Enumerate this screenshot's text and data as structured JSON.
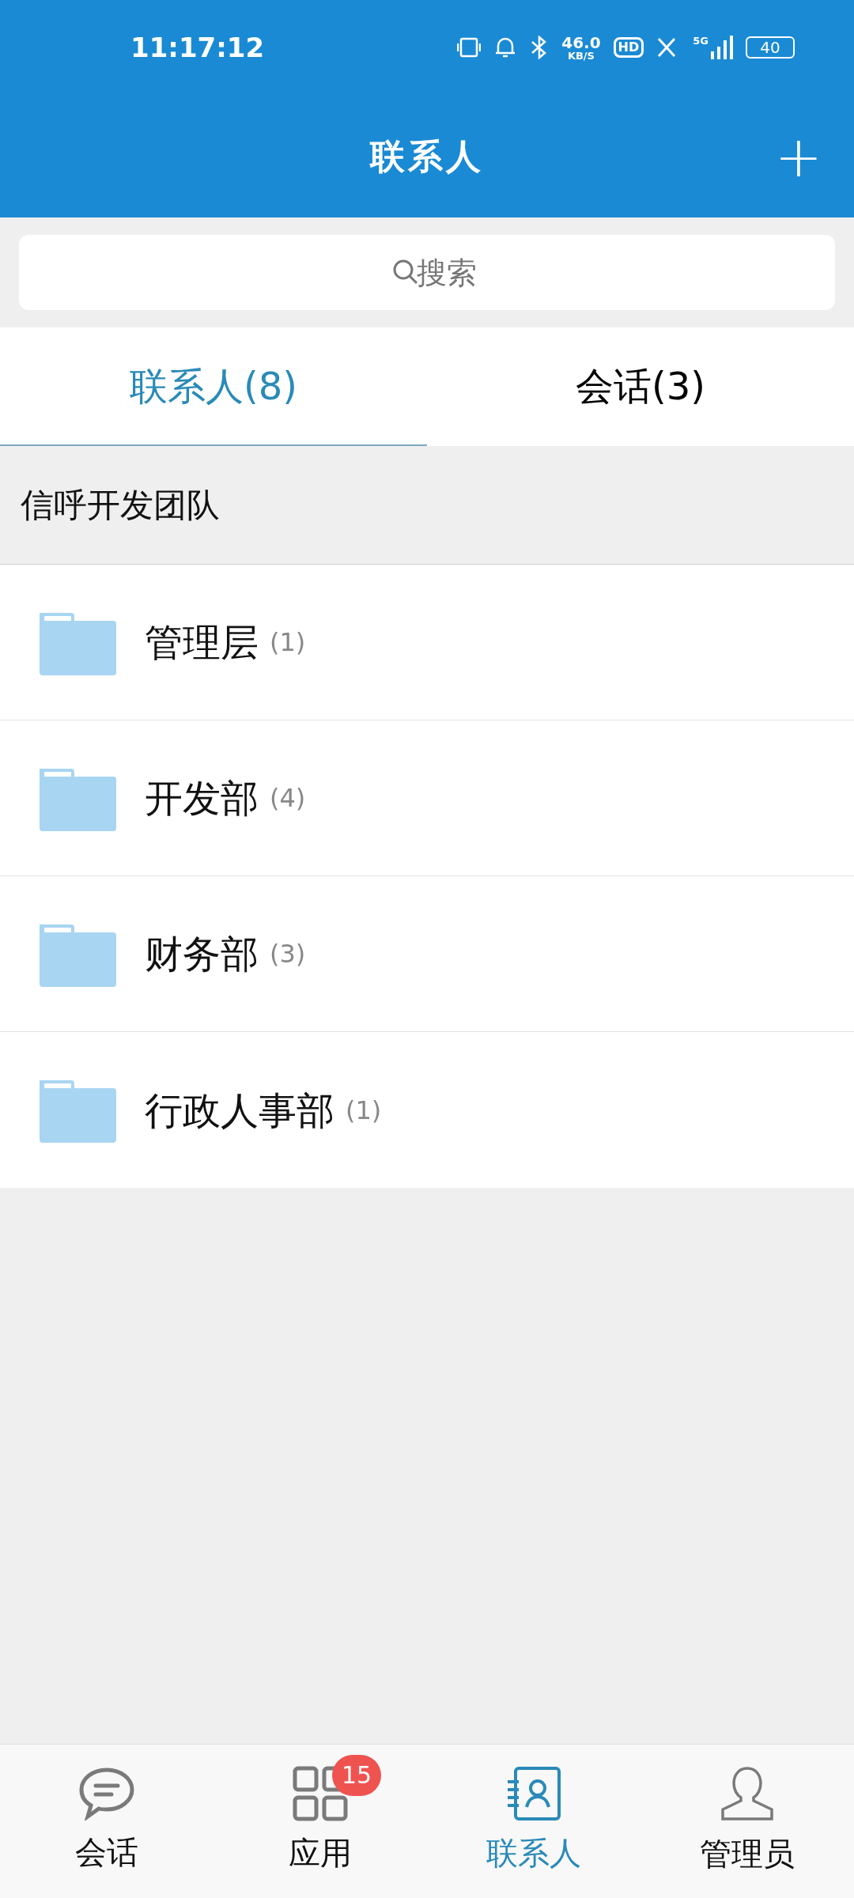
{
  "status_bar": {
    "time": "11:17:12",
    "net_speed": "46.0",
    "net_unit": "KB/S",
    "hd": "HD",
    "network": "5G",
    "battery": "40"
  },
  "header": {
    "title": "联系人",
    "add": "+"
  },
  "search": {
    "placeholder": "搜索"
  },
  "tabs": [
    {
      "label": "联系人(8)",
      "selected": true
    },
    {
      "label": "会话(3)",
      "selected": false
    }
  ],
  "group": {
    "title": "信呼开发团队"
  },
  "folders": [
    {
      "name": "管理层",
      "count": "(1)"
    },
    {
      "name": "开发部",
      "count": "(4)"
    },
    {
      "name": "财务部",
      "count": "(3)"
    },
    {
      "name": "行政人事部",
      "count": "(1)"
    }
  ],
  "bottom_nav": [
    {
      "kind": "chat",
      "label": "会话",
      "selected": false
    },
    {
      "kind": "apps",
      "label": "应用",
      "selected": false,
      "badge": "15"
    },
    {
      "kind": "contacts",
      "label": "联系人",
      "selected": true
    },
    {
      "kind": "user",
      "label": "管理员",
      "selected": false
    }
  ]
}
